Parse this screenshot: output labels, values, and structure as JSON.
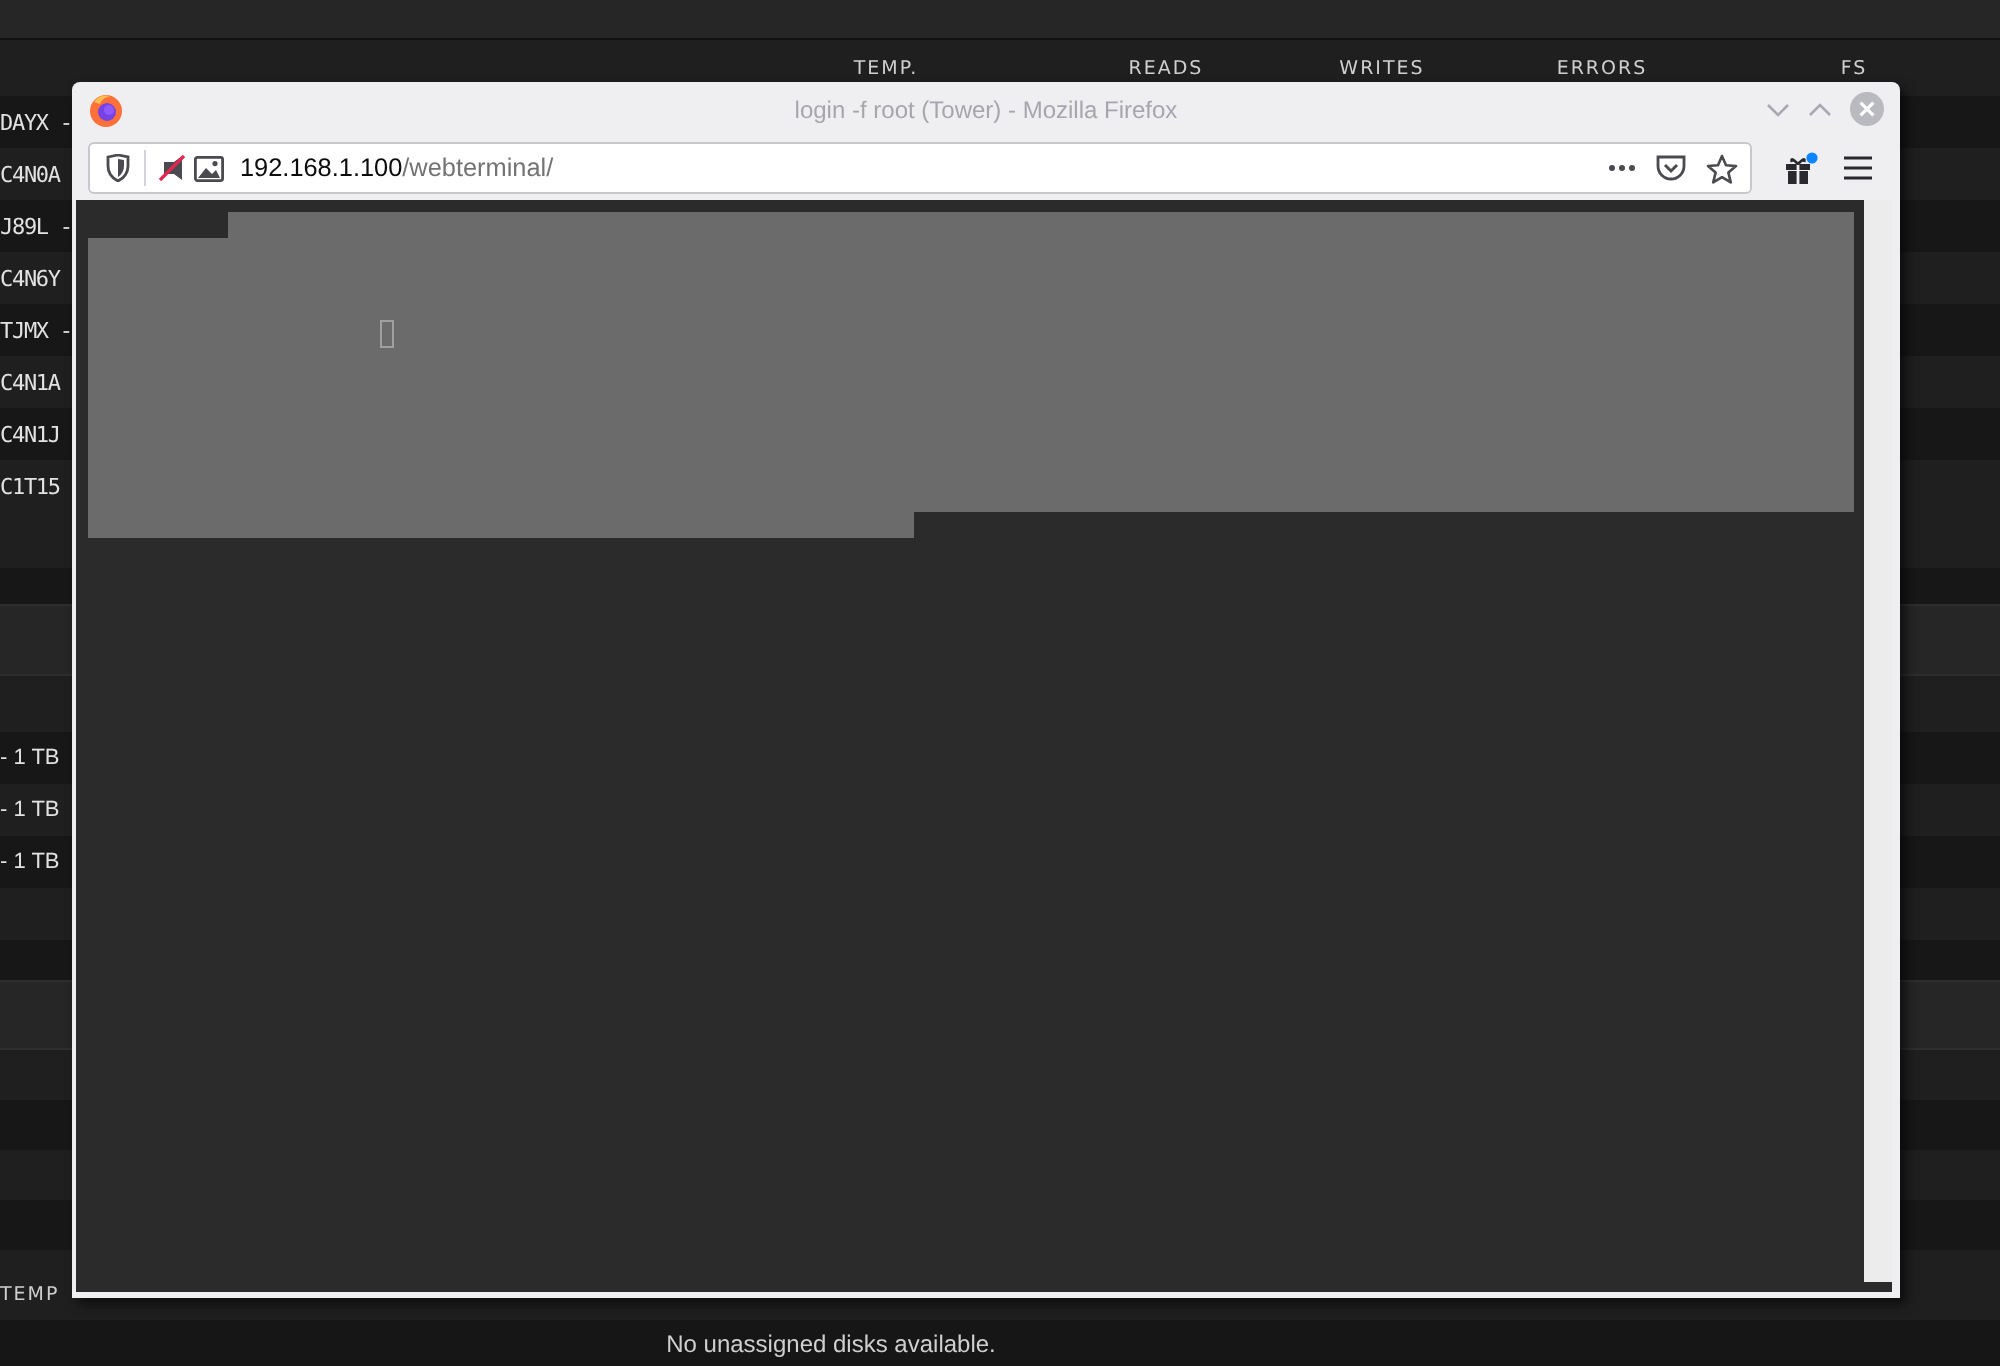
{
  "dashboard": {
    "disk_table": {
      "columns": [
        "TEMP.",
        "READS",
        "WRITES",
        "ERRORS",
        "FS"
      ],
      "rows": [
        {
          "column_1": "DAYX -"
        },
        {
          "column_1": "C4N0A"
        },
        {
          "column_1": "J89L -"
        },
        {
          "column_1": "C4N6Y"
        },
        {
          "column_1": "TJMX -"
        },
        {
          "column_1": "C4N1A"
        },
        {
          "column_1": "C4N1J"
        },
        {
          "column_1": "C1T15"
        }
      ]
    },
    "pool_table": {
      "rows": [
        {
          "column_1": "- 1 TB"
        },
        {
          "column_1": "- 1 TB"
        },
        {
          "column_1": "- 1 TB"
        }
      ]
    },
    "unassigned_table": {
      "columns": [
        "TEMP"
      ],
      "message": "No unassigned disks available."
    }
  },
  "browser_window": {
    "title": "login -f root (Tower) - Mozilla Firefox",
    "address_bar": {
      "host": "192.168.1.100",
      "path": "/webterminal/"
    }
  }
}
